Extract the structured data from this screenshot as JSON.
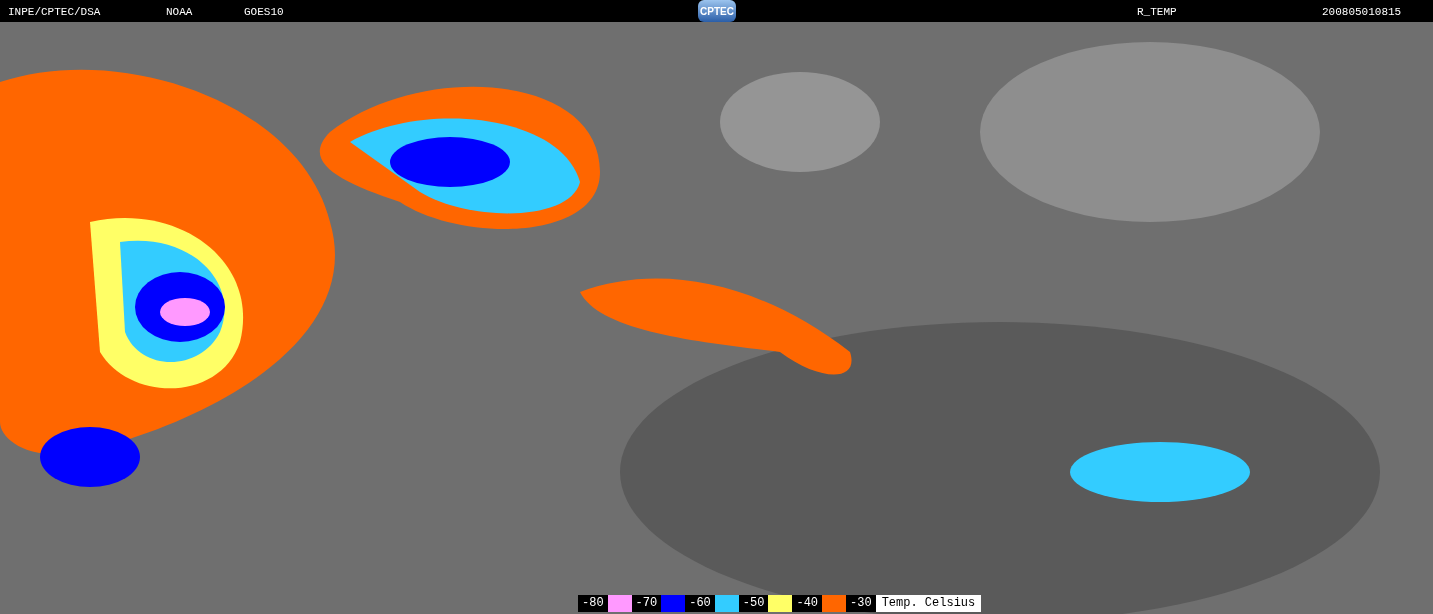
{
  "header": {
    "source": "INPE/CPTEC/DSA",
    "agency": "NOAA",
    "satellite": "GOES10",
    "logo": "CPTEC",
    "product": "R_TEMP",
    "timestamp": "200805010815"
  },
  "legend": {
    "items": [
      {
        "label": "-80",
        "color": "#ff99ff"
      },
      {
        "label": "-70",
        "color": "#0000ff"
      },
      {
        "label": "-60",
        "color": "#33ccff"
      },
      {
        "label": "-50",
        "color": "#ffff66"
      },
      {
        "label": "-40",
        "color": "#ff6600"
      },
      {
        "label": "-30"
      }
    ],
    "unit": "Temp. Celsius"
  }
}
